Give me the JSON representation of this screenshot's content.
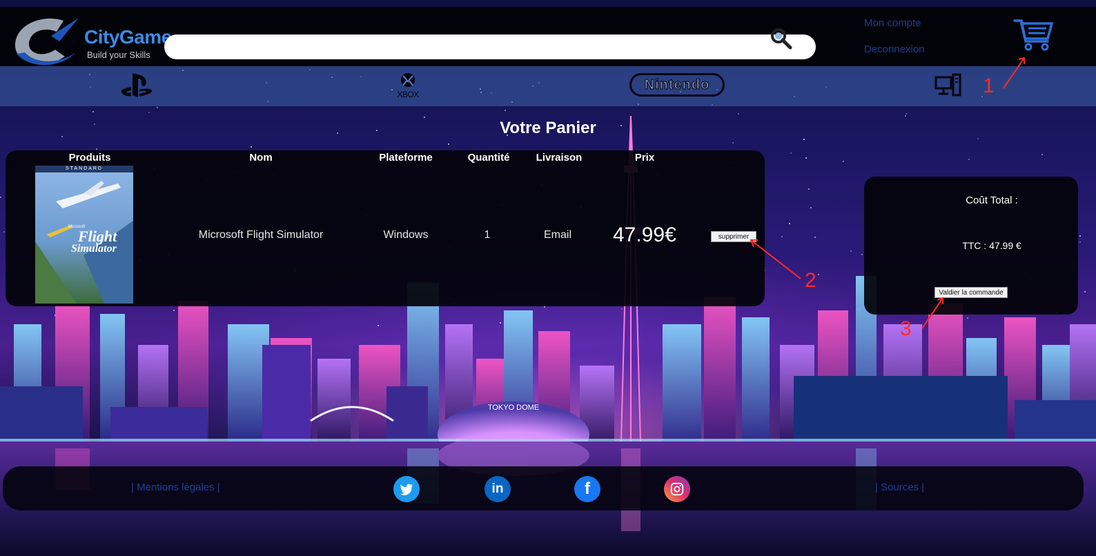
{
  "header": {
    "brand_title": "CityGame",
    "brand_tagline": "Build your Skills",
    "search_value": "",
    "account_link": "Mon compte",
    "logout_link": "Deconnexion"
  },
  "platforms": [
    {
      "name": "playstation-icon"
    },
    {
      "name": "xbox-icon",
      "label": "XBOX"
    },
    {
      "name": "nintendo-icon",
      "label": "Nintendo"
    },
    {
      "name": "pc-icon"
    }
  ],
  "cart": {
    "title": "Votre Panier",
    "columns": [
      "Produits",
      "Nom",
      "Plateforme",
      "Quantité",
      "Livraison",
      "Prix"
    ],
    "items": [
      {
        "cover_label": "STANDARD",
        "cover_title_1": "Flight",
        "cover_title_2": "Simulator",
        "cover_brand": "Microsoft",
        "name": "Microsoft Flight Simulator",
        "platform": "Windows",
        "quantity": "1",
        "delivery": "Email",
        "price": "47.99€",
        "remove_label": "supprimer"
      }
    ]
  },
  "summary": {
    "total_label": "Coût Total :",
    "ttc": "TTC : 47.99 €",
    "validate_label": "Valdier la commande"
  },
  "annotations": [
    "1",
    "2",
    "3"
  ],
  "skyline": {
    "dome_label": "TOKYO DOME"
  },
  "footer": {
    "legal": "| Mentions légales |",
    "sources": "| Sources |",
    "social": [
      "twitter-icon",
      "linkedin-icon",
      "facebook-icon",
      "instagram-icon"
    ]
  },
  "colors": {
    "brand_blue": "#3d8be6",
    "link_blue": "#1f3d9a",
    "annotation_red": "#ff2a2a",
    "twitter": "#1d9bf0",
    "linkedin": "#0a66c2",
    "facebook": "#1877f2"
  }
}
